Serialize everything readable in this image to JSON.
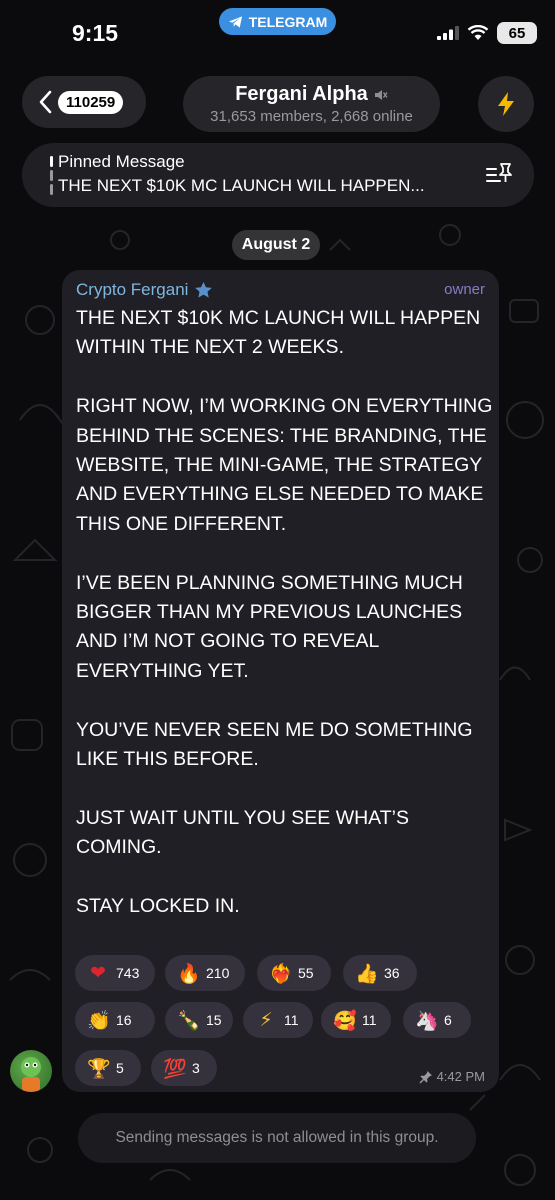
{
  "status_bar": {
    "time": "9:15",
    "app_pill": "TELEGRAM",
    "battery": "65"
  },
  "header": {
    "back_count": "110259",
    "title": "Fergani Alpha",
    "subtitle": "31,653 members, 2,668 online",
    "icons": {
      "back": "chevron-left-icon",
      "muted": "muted-speaker-icon",
      "action": "lightning-icon"
    }
  },
  "pinned": {
    "label": "Pinned Message",
    "text": "THE NEXT $10K MC LAUNCH WILL HAPPEN..."
  },
  "date_chip": "August 2",
  "message": {
    "sender": "Crypto Fergani",
    "role": "owner",
    "text": "THE NEXT $10K MC LAUNCH WILL HAPPEN WITHIN THE NEXT 2 WEEKS.\n\nRIGHT NOW, I’M WORKING ON EVERYTHING BEHIND THE SCENES: THE BRANDING, THE WEBSITE, THE MINI-GAME, THE STRATEGY AND EVERYTHING ELSE NEEDED TO MAKE THIS ONE DIFFERENT.\n\nI’VE BEEN PLANNING SOMETHING MUCH BIGGER THAN MY PREVIOUS LAUNCHES AND I’M NOT GOING TO REVEAL EVERYTHING YET.\n\nYOU’VE NEVER SEEN ME DO SOMETHING LIKE THIS BEFORE.\n\nJUST WAIT UNTIL YOU SEE WHAT’S COMING.\n\nSTAY LOCKED IN.",
    "time": "4:42 PM",
    "reactions": [
      {
        "emoji": "❤",
        "count": "743",
        "color": "#e0242d"
      },
      {
        "emoji": "🔥",
        "count": "210",
        "color": "#f07a1a"
      },
      {
        "emoji": "❤‍🔥",
        "count": "55",
        "color": "#e0242d"
      },
      {
        "emoji": "👍",
        "count": "36",
        "color": "#f5c33b"
      },
      {
        "emoji": "👏",
        "count": "16",
        "color": "#f5c33b"
      },
      {
        "emoji": "🍾",
        "count": "15",
        "color": "#4caf50"
      },
      {
        "emoji": "⚡",
        "count": "11",
        "color": "#f5c33b"
      },
      {
        "emoji": "🥰",
        "count": "11",
        "color": "#f5c33b"
      },
      {
        "emoji": "🦄",
        "count": "6",
        "color": "#c8a0ff"
      },
      {
        "emoji": "🏆",
        "count": "5",
        "color": "#f5b41a"
      },
      {
        "emoji": "💯",
        "count": "3",
        "color": "#e0242d"
      }
    ]
  },
  "bottom_notice": "Sending messages is not allowed in this group."
}
